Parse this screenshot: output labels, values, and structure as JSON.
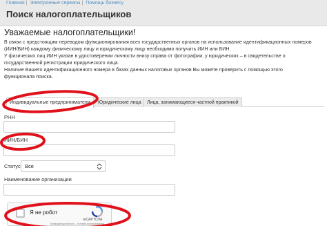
{
  "breadcrumb": {
    "items": [
      "Главная",
      "Электронные сервисы",
      "Помощь бизнесу"
    ]
  },
  "page": {
    "title": "Поиск налогоплательщиков",
    "greeting": "Уважаемые налогоплательщики!",
    "intro_lines": [
      "В связи с предстоящим переводом функционирования всех государственных органов на использование идентификационных номеров",
      "(ИИН/БИН) каждому физическому лицу и юридическому лицу необходимо получить ИИН или БИН.",
      "У физических лиц ИИН указан в удостоверении личности внизу справа от фотографии, у юридических – в свидетельстве о",
      "государственной регистрации юридического лица.",
      "Наличие Вашего идентификационного номера в базах данных налоговых органов Вы можете проверить с помощью этого",
      "функционала поиска."
    ]
  },
  "tabs": [
    {
      "label": "Индивидуальные предприниматели",
      "active": true
    },
    {
      "label": "Юридические лица",
      "active": false
    },
    {
      "label": "Лица, занимающиеся частной практикой",
      "active": false
    }
  ],
  "form": {
    "rnn_label": "РНН",
    "iin_label": "ИИН/БИН",
    "status_label": "Статус",
    "status_value": "Все",
    "name_label": "Наименование организации"
  },
  "captcha": {
    "label": "Я не робот",
    "brand": "reCAPTCHA",
    "terms": "Конфиденциальность - Условия использования"
  },
  "colors": {
    "annotation": "#e0111a",
    "link": "#4f8fc5",
    "header_bg": "#e9e9e9"
  }
}
